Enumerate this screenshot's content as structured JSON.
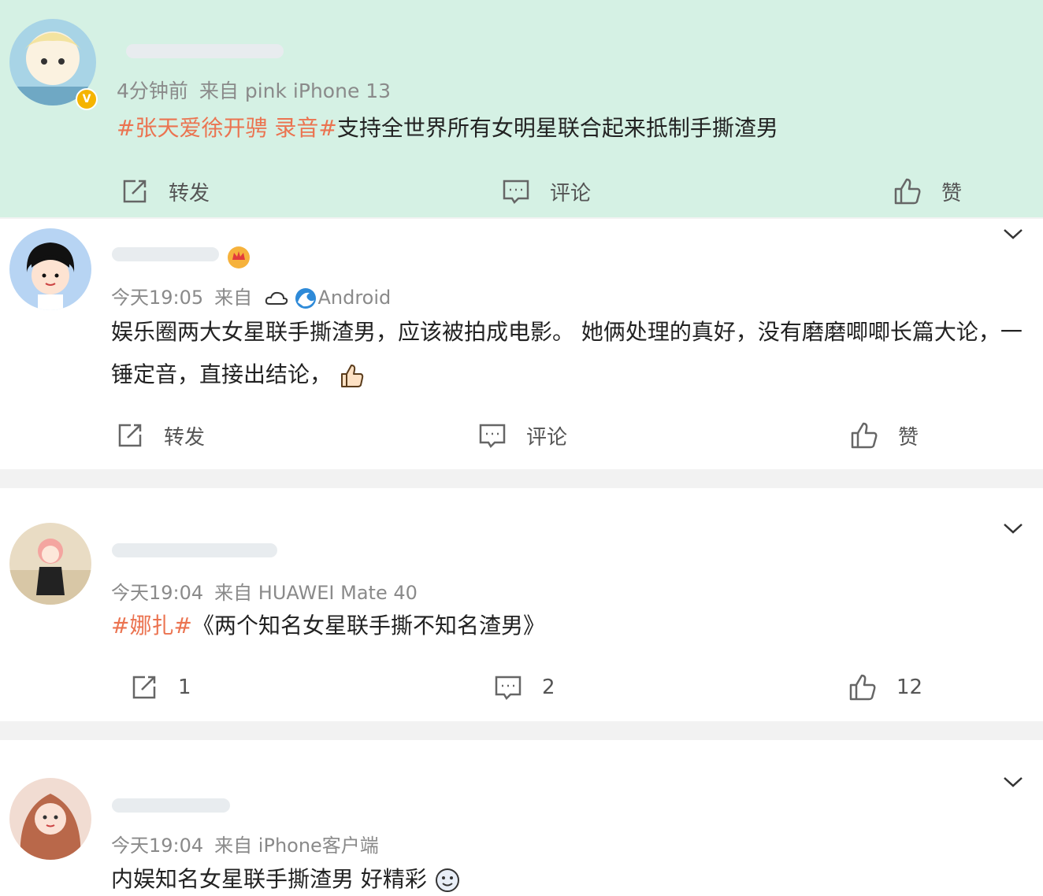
{
  "posts": [
    {
      "time": "4分钟前",
      "source": "来自 pink iPhone 13",
      "tags": "#张天爱徐开骋 录音#",
      "text": "支持全世界所有女明星联合起来抵制手撕渣男",
      "actions": {
        "repost": "转发",
        "comment": "评论",
        "like": "赞"
      }
    },
    {
      "time": "今天19:05",
      "source_prefix": "来自",
      "source": "Android",
      "text": "娱乐圈两大女星联手撕渣男，应该被拍成电影。 她俩处理的真好，没有磨磨唧唧长篇大论，一锤定音，直接出结论，",
      "actions": {
        "repost": "转发",
        "comment": "评论",
        "like": "赞"
      }
    },
    {
      "time": "今天19:04",
      "source": "来自 HUAWEI Mate 40",
      "tags": "#娜扎#",
      "text": "《两个知名女星联手撕不知名渣男》",
      "actions": {
        "repost": "1",
        "comment": "2",
        "like": "12"
      }
    },
    {
      "time": "今天19:04",
      "source": "来自 iPhone客户端",
      "text": "内娱知名女星联手撕渣男 好精彩"
    }
  ],
  "icons": {
    "repost": "repost-icon",
    "comment": "comment-icon",
    "like": "thumbs-up-icon",
    "expand": "chevron-down-icon",
    "verified": "verified-badge-icon"
  },
  "colors": {
    "tag": "#eb7350",
    "highlight_bg": "#d5f1e4",
    "meta": "#8a8a8a"
  }
}
